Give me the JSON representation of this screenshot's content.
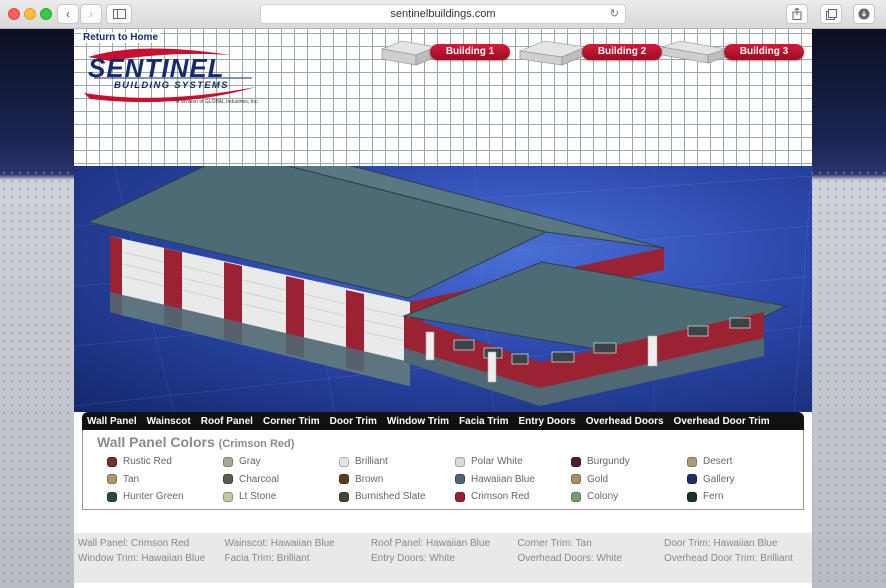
{
  "browser": {
    "url": "sentinelbuildings.com"
  },
  "header": {
    "return_link": "Return to Home",
    "logo_word": "SENTINEL",
    "logo_sub": "BUILDING SYSTEMS",
    "logo_division": "A Division of GLOBAL Industries, Inc.",
    "buildings": [
      {
        "label": "Building 1"
      },
      {
        "label": "Building 2"
      },
      {
        "label": "Building 3"
      }
    ]
  },
  "tabs": [
    "Wall Panel",
    "Wainscot",
    "Roof Panel",
    "Corner Trim",
    "Door Trim",
    "Window Trim",
    "Facia Trim",
    "Entry Doors",
    "Overhead Doors",
    "Overhead Door Trim"
  ],
  "colors_panel": {
    "title": "Wall Panel Colors",
    "selected": "(Crimson Red)",
    "swatches": [
      {
        "name": "Rustic Red",
        "color": "#7a2e30"
      },
      {
        "name": "Tan",
        "color": "#a89a70"
      },
      {
        "name": "Hunter Green",
        "color": "#2e4a34"
      },
      {
        "name": "Gray",
        "color": "#a6a89c"
      },
      {
        "name": "Charcoal",
        "color": "#5a5a52"
      },
      {
        "name": "Lt Stone",
        "color": "#c7c4a6"
      },
      {
        "name": "Brilliant",
        "color": "#dfe6ea"
      },
      {
        "name": "Brown",
        "color": "#5e3a26"
      },
      {
        "name": "Burnished Slate",
        "color": "#4a4436"
      },
      {
        "name": "Polar White",
        "color": "#d9dcd6"
      },
      {
        "name": "Hawaiian Blue",
        "color": "#4b6674"
      },
      {
        "name": "Crimson Red",
        "color": "#9a2030"
      },
      {
        "name": "Burgundy",
        "color": "#4e1e2a"
      },
      {
        "name": "Gold",
        "color": "#a99060"
      },
      {
        "name": "Colony",
        "color": "#7e987a"
      },
      {
        "name": "Desert",
        "color": "#a89e76"
      },
      {
        "name": "Gallery",
        "color": "#1e2e68"
      },
      {
        "name": "Fern",
        "color": "#163420"
      }
    ]
  },
  "summary": [
    "Wall Panel: Crimson Red",
    "Window Trim: Hawaiian Blue",
    "Wainscot: Hawaiian Blue",
    "Facia Trim: Brilliant",
    "Roof Panel: Hawaiian Blue",
    "Entry Doors: White",
    "Corner Trim: Tan",
    "Overhead Doors: White",
    "Door Trim: Hawaiian Blue",
    "Overhead Door Trim: Brilliant"
  ],
  "colors": {
    "roof": "#4d6b75",
    "wall": "#9b2232",
    "wainscot": "#4f6873",
    "accent": "#c8102e",
    "brand": "#152b6d"
  }
}
